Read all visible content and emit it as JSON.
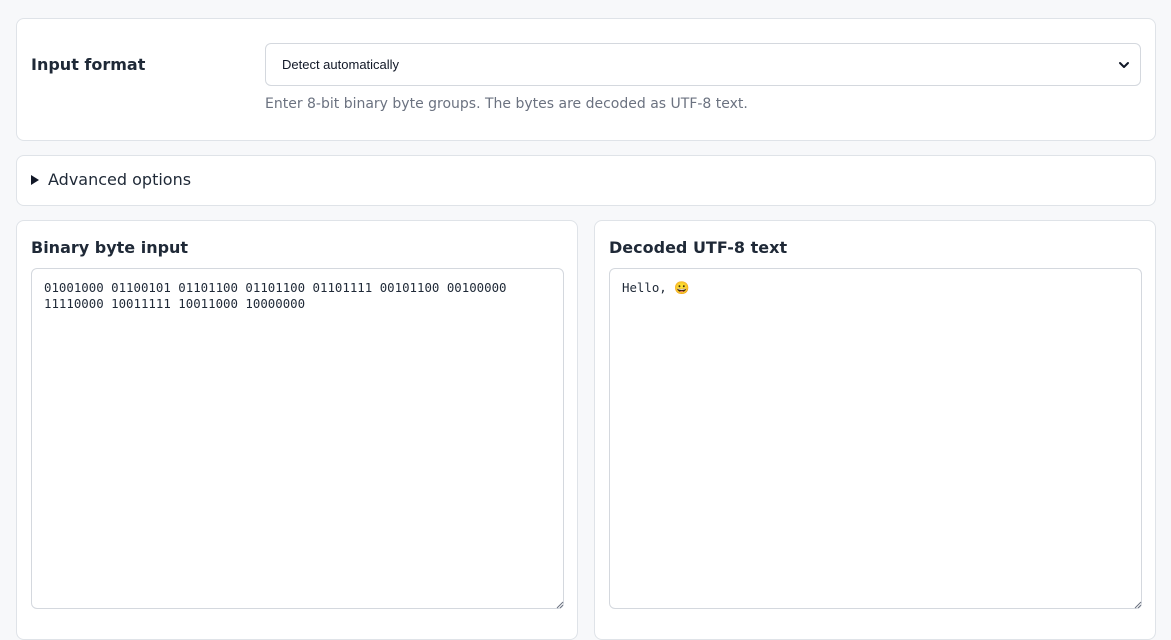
{
  "format": {
    "label": "Input format",
    "selected": "Detect automatically",
    "hint": "Enter 8-bit binary byte groups. The bytes are decoded as UTF-8 text."
  },
  "advanced": {
    "label": "Advanced options"
  },
  "binary_panel": {
    "title": "Binary byte input",
    "value": "01001000 01100101 01101100 01101100 01101111 00101100 00100000 11110000 10011111 10011000 10000000"
  },
  "decoded_panel": {
    "title": "Decoded UTF-8 text",
    "value": "Hello, 😀"
  },
  "icons": {
    "select_arrow": "chevron-down-icon",
    "disclosure": "disclosure-triangle-icon",
    "resize": "resize-grip-icon"
  }
}
